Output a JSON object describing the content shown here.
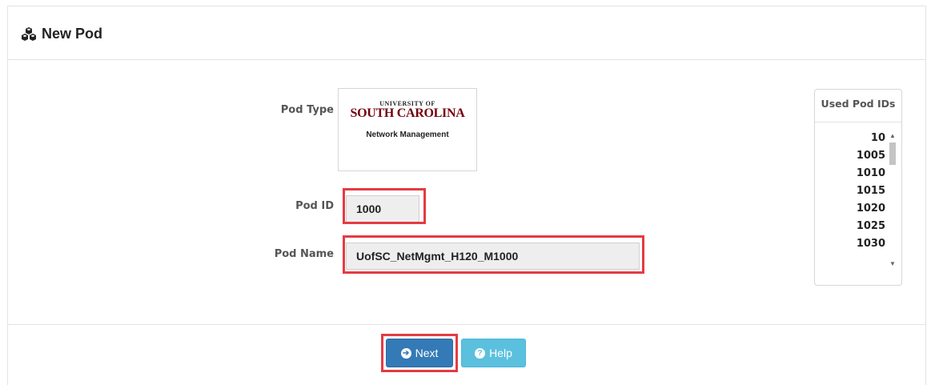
{
  "header": {
    "title": "New Pod",
    "icon": "cubes-icon"
  },
  "form": {
    "pod_type_label": "Pod Type",
    "pod_type_logo": {
      "line1": "UNIVERSITY OF",
      "line2": "SOUTH CAROLINA",
      "line3": "Network Management"
    },
    "pod_id_label": "Pod ID",
    "pod_id_value": "1000",
    "pod_name_label": "Pod Name",
    "pod_name_value": "UofSC_NetMgmt_H120_M1000"
  },
  "used_pod_ids": {
    "title": "Used Pod IDs",
    "items": [
      "10",
      "1005",
      "1010",
      "1015",
      "1020",
      "1025",
      "1030"
    ]
  },
  "buttons": {
    "next_label": "Next",
    "next_icon": "arrow-circle-right-icon",
    "help_label": "Help",
    "help_icon": "question-circle-icon"
  },
  "colors": {
    "highlight": "#e43b43",
    "primary": "#337ab7",
    "info": "#5bc0de",
    "brand_garnet": "#73000a"
  }
}
